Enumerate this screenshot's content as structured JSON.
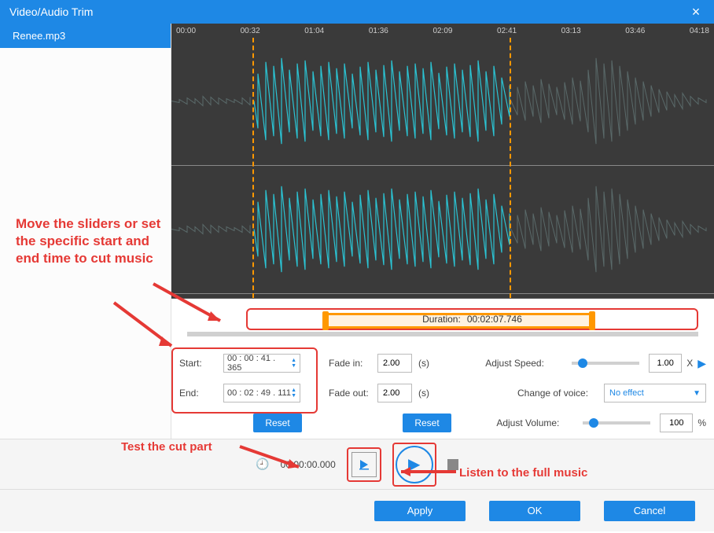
{
  "window": {
    "title": "Video/Audio Trim"
  },
  "sidebar": {
    "filename": "Renee.mp3"
  },
  "timeline": {
    "ticks": [
      "00:00",
      "00:32",
      "01:04",
      "01:36",
      "02:09",
      "02:41",
      "03:13",
      "03:46",
      "04:18"
    ]
  },
  "duration": {
    "label": "Duration:",
    "value": "00:02:07.746"
  },
  "trim": {
    "start_label": "Start:",
    "start_value": "00 : 00 : 41 . 365",
    "end_label": "End:",
    "end_value": "00 : 02 : 49 . 111",
    "reset": "Reset"
  },
  "fade": {
    "in_label": "Fade in:",
    "in_value": "2.00",
    "out_label": "Fade out:",
    "out_value": "2.00",
    "unit": "(s)",
    "reset": "Reset"
  },
  "adjust": {
    "speed_label": "Adjust Speed:",
    "speed_value": "1.00",
    "speed_unit": "X",
    "voice_label": "Change of voice:",
    "voice_value": "No effect",
    "volume_label": "Adjust Volume:",
    "volume_value": "100",
    "volume_unit": "%"
  },
  "playback": {
    "time": "00:00:00.000"
  },
  "buttons": {
    "apply": "Apply",
    "ok": "OK",
    "cancel": "Cancel"
  },
  "annotations": {
    "a1": "Move the sliders or set the specific start and end time to cut music",
    "a2": "Test the cut part",
    "a3": "Listen to the full music"
  }
}
